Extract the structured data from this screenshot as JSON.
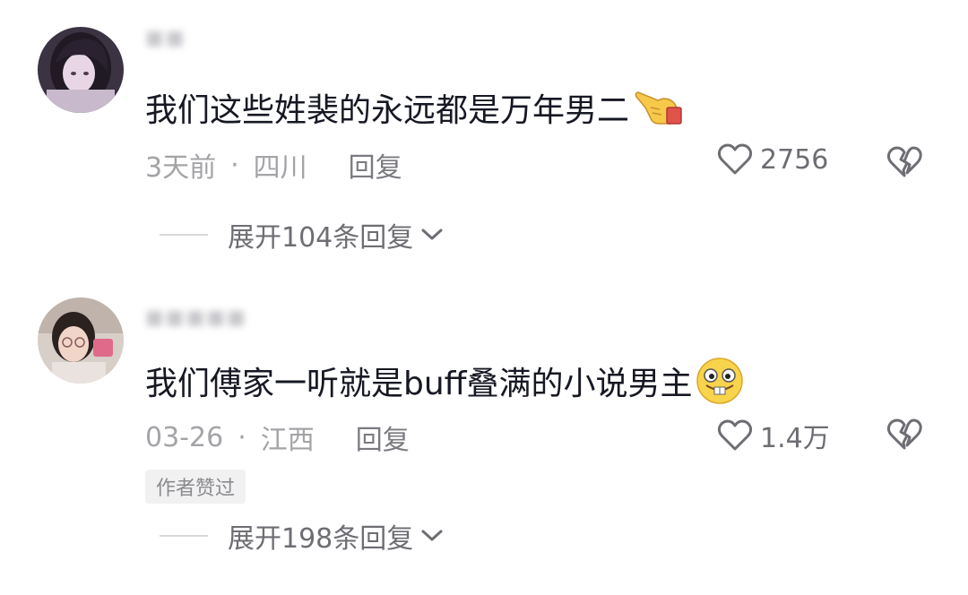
{
  "comments": [
    {
      "text": "我们这些姓裴的永远都是万年男二",
      "emoji_icon": "backhand-index-pointing-left-emoji",
      "time": "3天前",
      "separator": "·",
      "location": "四川",
      "reply_label": "回复",
      "like_count": "2756",
      "expand_label": "展开104条回复"
    },
    {
      "text": "我们傅家一听就是buff叠满的小说男主",
      "emoji_icon": "buck-teeth-smiley-emoji",
      "time": "03-26",
      "separator": "·",
      "location": "江西",
      "reply_label": "回复",
      "like_count": "1.4万",
      "author_badge": "作者赞过",
      "expand_label": "展开198条回复"
    }
  ],
  "colors": {
    "primary_text": "#161823",
    "secondary_text": "#a4a4a8",
    "icon": "#6d6d73"
  }
}
